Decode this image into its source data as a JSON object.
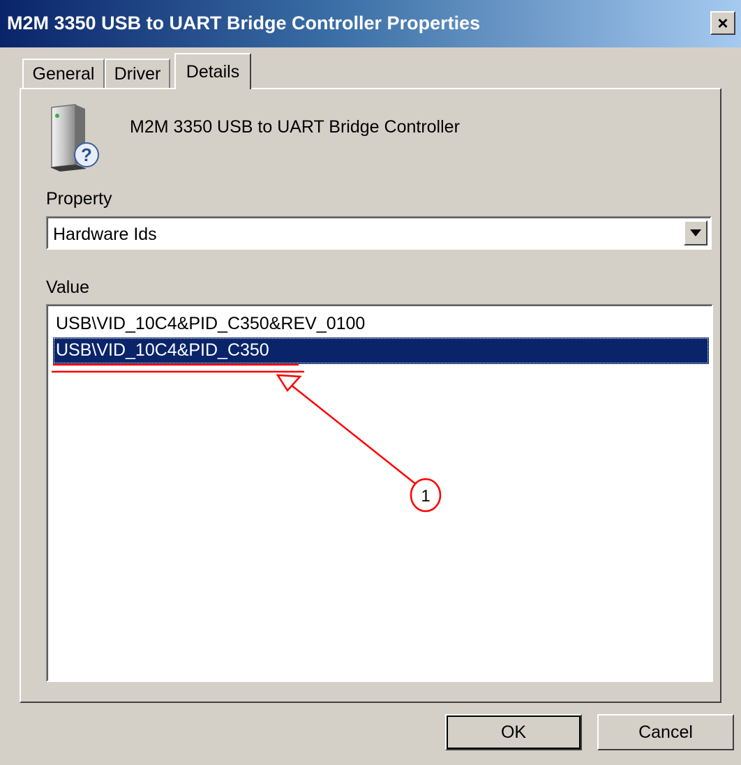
{
  "window": {
    "title": "M2M 3350 USB to UART Bridge Controller Properties",
    "close_label": "×"
  },
  "tabs": [
    {
      "label": "General",
      "active": false
    },
    {
      "label": "Driver",
      "active": false
    },
    {
      "label": "Details",
      "active": true
    }
  ],
  "device": {
    "name": "M2M 3350 USB to UART Bridge Controller",
    "icon": "device-unknown-icon"
  },
  "property": {
    "label": "Property",
    "selected": "Hardware Ids"
  },
  "value": {
    "label": "Value",
    "items": [
      {
        "text": "USB\\VID_10C4&PID_C350&REV_0100",
        "selected": false
      },
      {
        "text": "USB\\VID_10C4&PID_C350",
        "selected": true
      }
    ]
  },
  "annotation": {
    "number": "1",
    "color": "#ff0000"
  },
  "buttons": {
    "ok_label": "OK",
    "cancel_label": "Cancel"
  },
  "colors": {
    "selection": "#0a246a",
    "face": "#d4d0c8"
  }
}
